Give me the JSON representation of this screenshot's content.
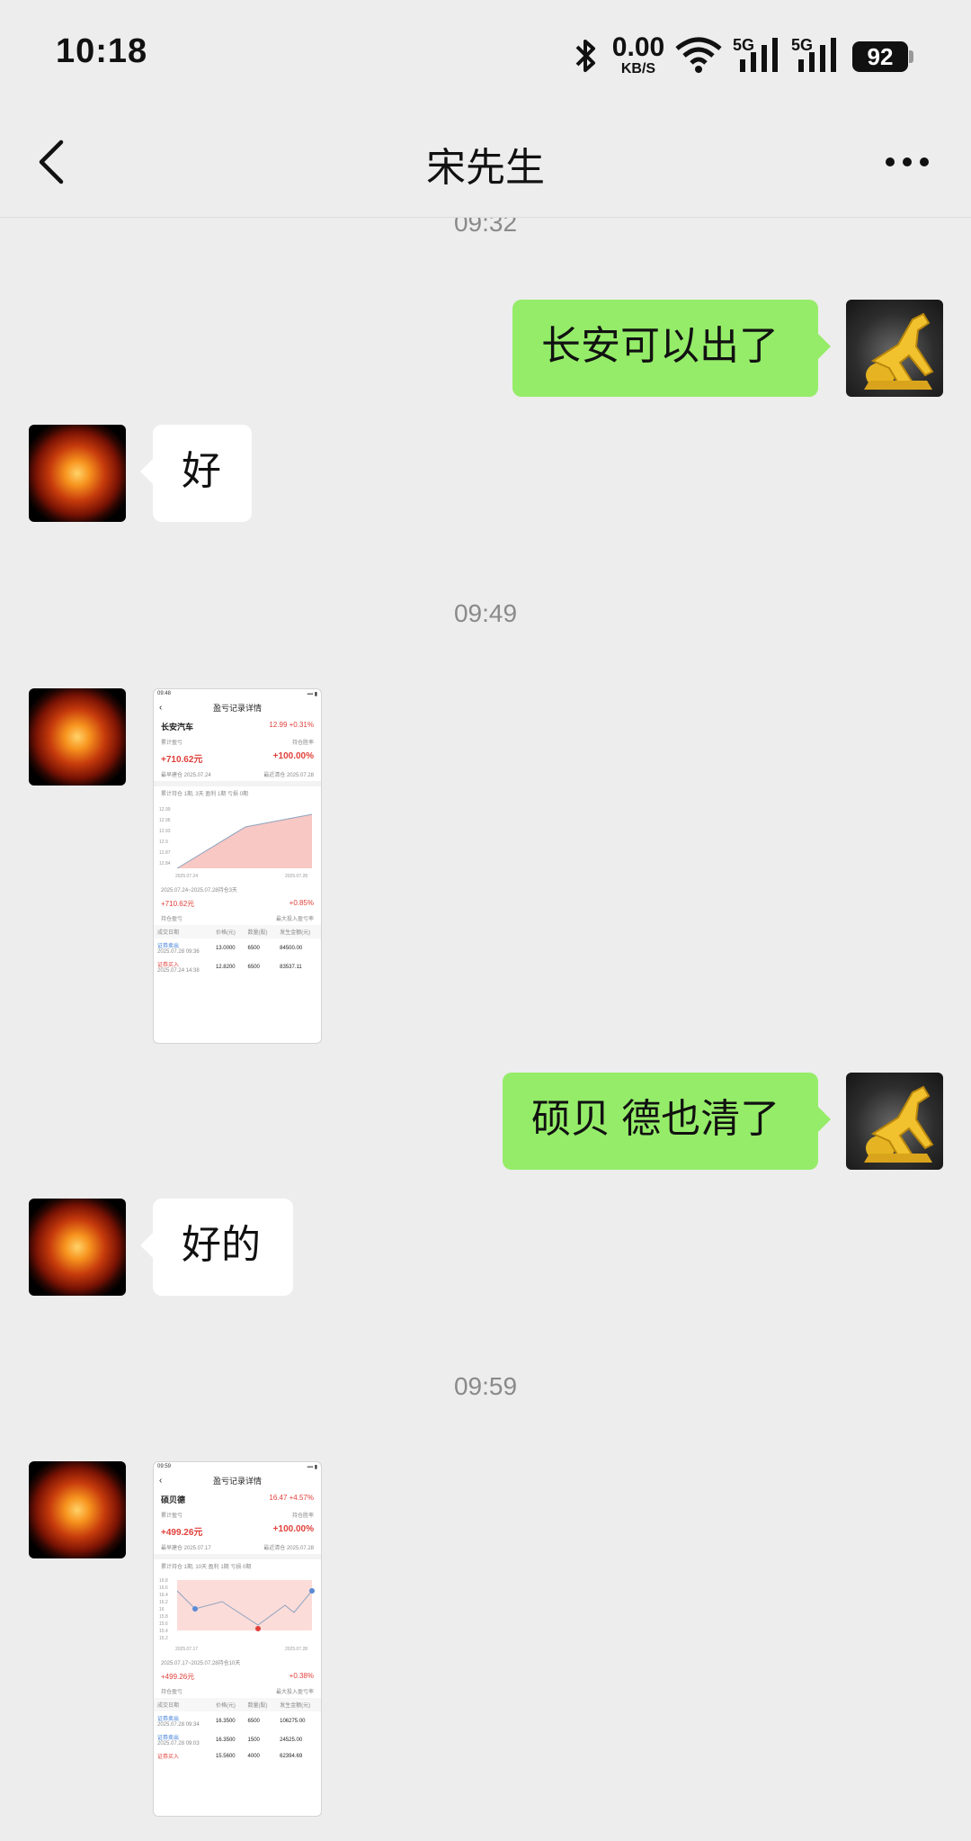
{
  "status": {
    "time": "10:18",
    "net_value": "0.00",
    "net_unit": "KB/S",
    "sig1": "5G",
    "sig2": "5G",
    "battery": "92"
  },
  "header": {
    "title": "宋先生"
  },
  "timestamps": [
    "09:32",
    "09:49",
    "09:59"
  ],
  "messages": [
    {
      "text": "长安可以出了"
    },
    {
      "text": "好"
    },
    {
      "text": "硕贝 德也清了"
    },
    {
      "text": "好的"
    }
  ],
  "shot1": {
    "status_time": "09:48",
    "title": "盈亏记录详情",
    "stock": "长安汽车",
    "price": "12.99 +0.31%",
    "pl_label": "累计盈亏",
    "rate_label": "持仓胜率",
    "pl": "+710.62元",
    "rate": "+100.00%",
    "first_buy": "最早建仓 2025.07.24",
    "last_clear": "最近清仓 2025.07.28",
    "summary": "累计持仓 1期, 3天   盈利 1期   亏损 0期",
    "yticks": [
      "12.99",
      "12.96",
      "12.93",
      "12.9",
      "12.87",
      "12.84"
    ],
    "xticks": [
      "2025.07.24",
      "2025.07.28"
    ],
    "period": "2025.07.24~2025.07.28持仓3天",
    "period_pl": "+710.62元",
    "period_rate": "+0.85%",
    "period_pl_label": "持仓盈亏",
    "period_rate_label": "最大投入盈亏率",
    "cols": [
      "成交日期",
      "价格(元)",
      "数量(股)",
      "发生金额(元)"
    ],
    "rows": [
      {
        "type": "证券卖出",
        "date": "2025.07.28 09:36",
        "price": "13.0000",
        "qty": "6500",
        "amount": "84500.00"
      },
      {
        "type": "证券买入",
        "date": "2025.07.24 14:38",
        "price": "12.8200",
        "qty": "6500",
        "amount": "83537.11"
      }
    ]
  },
  "shot2": {
    "status_time": "09:59",
    "title": "盈亏记录详情",
    "stock": "硕贝德",
    "price": "16.47 +4.57%",
    "pl_label": "累计盈亏",
    "rate_label": "持仓胜率",
    "pl": "+499.26元",
    "rate": "+100.00%",
    "first_buy": "最早建仓 2025.07.17",
    "last_clear": "最近清仓 2025.07.28",
    "summary": "累计持仓 1期, 10天   盈利 1期   亏损 0期",
    "yticks": [
      "16.8",
      "16.6",
      "16.4",
      "16.2",
      "16",
      "15.8",
      "15.6",
      "15.4",
      "15.2"
    ],
    "xticks": [
      "2025.07.17",
      "2025.07.28"
    ],
    "period": "2025.07.17~2025.07.28持仓10天",
    "period_pl": "+499.26元",
    "period_rate": "+0.38%",
    "period_pl_label": "持仓盈亏",
    "period_rate_label": "最大投入盈亏率",
    "cols": [
      "成交日期",
      "价格(元)",
      "数量(股)",
      "发生金额(元)"
    ],
    "rows": [
      {
        "type": "证券卖出",
        "date": "2025.07.28 09:34",
        "price": "16.3500",
        "qty": "6500",
        "amount": "106275.00"
      },
      {
        "type": "证券卖出",
        "date": "2025.07.28 09:03",
        "price": "16.3500",
        "qty": "1500",
        "amount": "24525.00"
      },
      {
        "type": "证券买入",
        "date": "",
        "price": "15.5600",
        "qty": "4000",
        "amount": "62394.69"
      }
    ]
  }
}
